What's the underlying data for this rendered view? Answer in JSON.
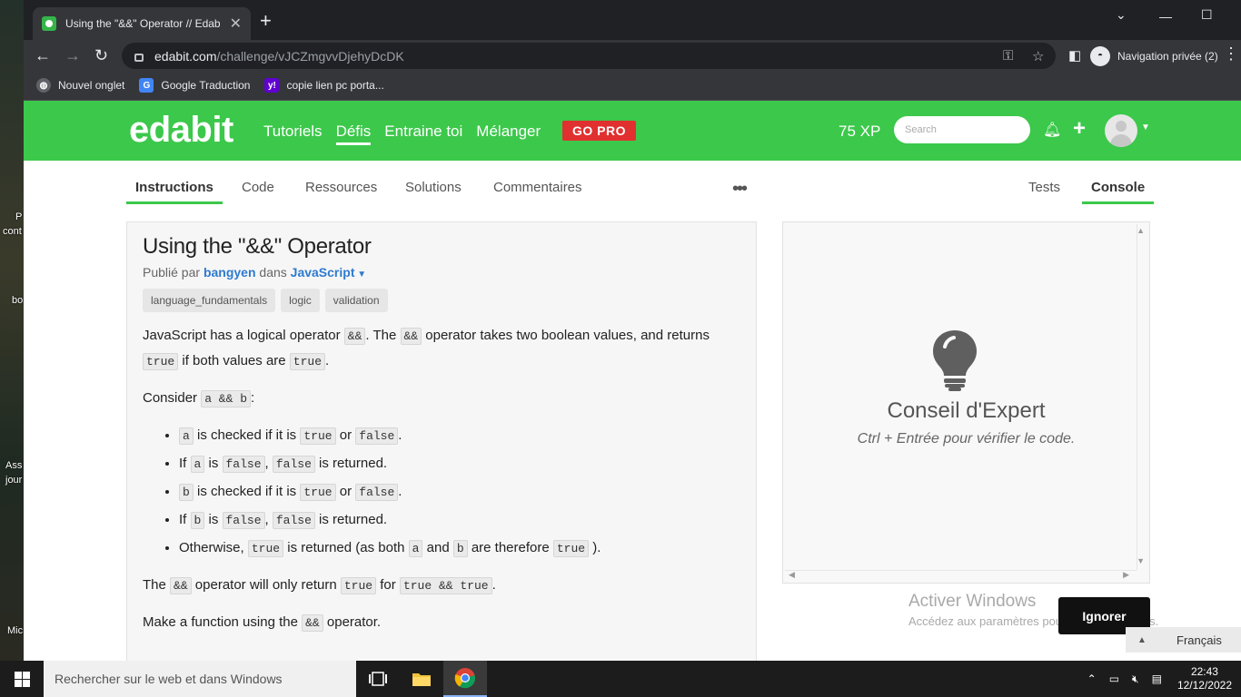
{
  "desktop": {
    "fragments": [
      "P",
      "cont",
      "bo",
      "Ass",
      "jour",
      "Mic"
    ]
  },
  "browser": {
    "tab_title": "Using the \"&&\" Operator // Edab",
    "url_domain": "edabit.com",
    "url_path": "/challenge/vJCZmgvvDjehyDcDK",
    "profile_label": "Navigation privée (2)",
    "bookmarks": [
      {
        "label": "Nouvel onglet",
        "icon": "globe-icon"
      },
      {
        "label": "Google Traduction",
        "icon": "google-translate-icon"
      },
      {
        "label": "copie lien pc porta...",
        "icon": "yahoo-icon"
      }
    ]
  },
  "site": {
    "logo": "edabit",
    "nav": [
      "Tutoriels",
      "Défis",
      "Entraine toi",
      "Mélanger"
    ],
    "nav_active": "Défis",
    "gopro": "GO PRO",
    "xp": "75 XP",
    "search_placeholder": "Search"
  },
  "subtabs": {
    "left": [
      "Instructions",
      "Code",
      "Ressources",
      "Solutions",
      "Commentaires"
    ],
    "right": [
      "Tests",
      "Console"
    ],
    "active_left": "Instructions",
    "active_right": "Console"
  },
  "challenge": {
    "title": "Using the \"&&\" Operator",
    "published_by": "Publié par",
    "author": "bangyen",
    "in": "dans",
    "language": "JavaScript",
    "tags": [
      "language_fundamentals",
      "logic",
      "validation"
    ],
    "p1": {
      "t1": "JavaScript has a logical operator ",
      "c1": "&&",
      "t2": ". The ",
      "c2": "&&",
      "t3": " operator takes two boolean values, and returns ",
      "c3": "true",
      "t4": " if both values are ",
      "c4": "true",
      "t5": "."
    },
    "p2": {
      "t1": "Consider ",
      "c1": "a && b",
      "t2": ":"
    },
    "bullets": {
      "b1": {
        "c1": "a",
        "t1": " is checked if it is ",
        "c2": "true",
        "t2": " or ",
        "c3": "false",
        "t3": "."
      },
      "b2": {
        "t0": "If ",
        "c1": "a",
        "t1": " is ",
        "c2": "false",
        "t2": ", ",
        "c3": "false",
        "t3": " is returned."
      },
      "b3": {
        "c1": "b",
        "t1": " is checked if it is ",
        "c2": "true",
        "t2": " or ",
        "c3": "false",
        "t3": "."
      },
      "b4": {
        "t0": "If ",
        "c1": "b",
        "t1": " is ",
        "c2": "false",
        "t2": ", ",
        "c3": "false",
        "t3": " is returned."
      },
      "b5": {
        "t0": "Otherwise, ",
        "c1": "true",
        "t1": " is returned (as both ",
        "c2": "a",
        "t2": " and ",
        "c3": "b",
        "t3": " are therefore ",
        "c4": "true",
        "t4": " )."
      }
    },
    "p3": {
      "t1": "The ",
      "c1": "&&",
      "t2": " operator will only return ",
      "c2": "true",
      "t3": " for ",
      "c3": "true && true",
      "t4": "."
    },
    "p4": {
      "t1": "Make a function using the ",
      "c1": "&&",
      "t2": " operator."
    }
  },
  "console": {
    "title": "Conseil d'Expert",
    "subtitle": "Ctrl + Entrée pour vérifier le code."
  },
  "windows": {
    "activate_title": "Activer Windows",
    "activate_sub": "Accédez aux paramètres pour activer Windows.",
    "ignore": "Ignorer",
    "language": "Français",
    "search": "Rechercher sur le web et dans Windows",
    "time": "22:43",
    "date": "12/12/2022"
  },
  "colors": {
    "brand_green": "#3cc84b",
    "gopro_red": "#e0302f",
    "link_blue": "#2e7bcf"
  }
}
